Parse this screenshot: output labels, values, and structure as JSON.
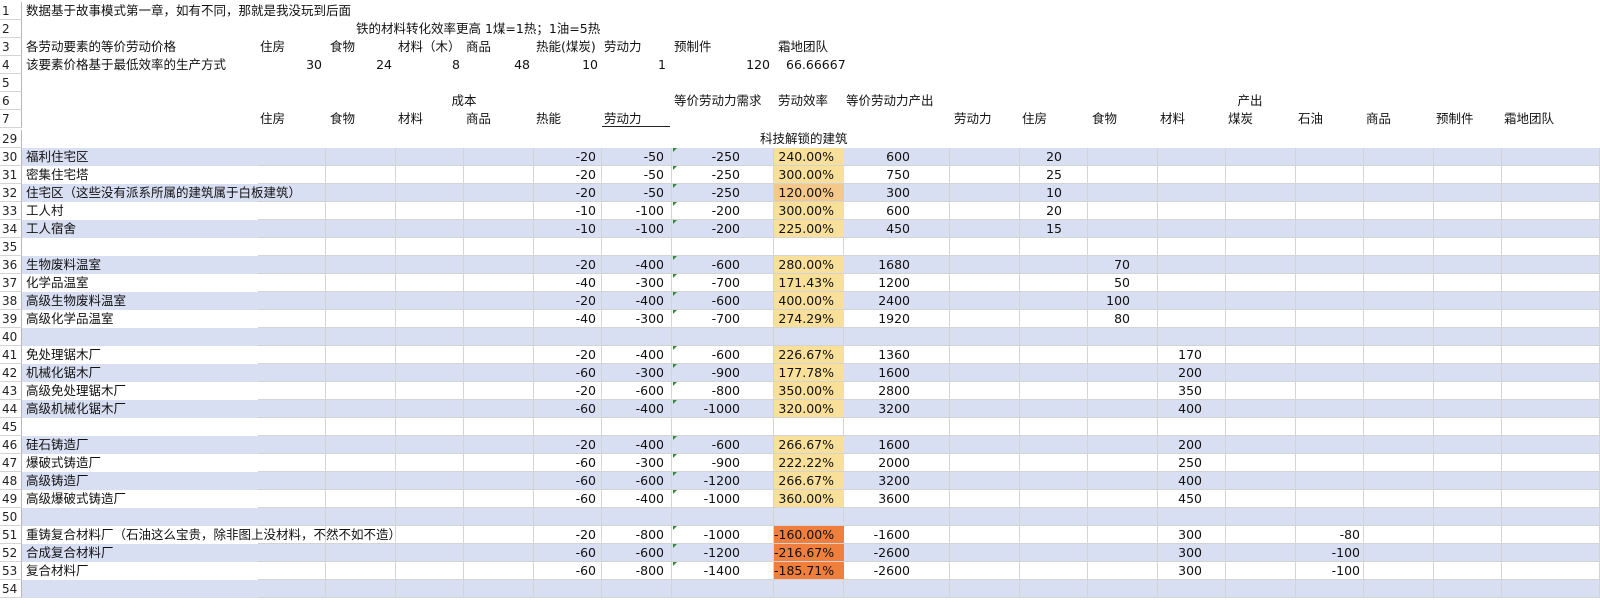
{
  "sheet": {
    "r1": {
      "num": "1",
      "a": "数据基于故事模式第一章，如有不同，那就是我没玩到后面"
    },
    "r2": {
      "num": "2",
      "note": "铁的材料转化效率更高  1煤=1热；1油=5热"
    },
    "r3": {
      "num": "3",
      "a": "各劳动要素的等价劳动价格",
      "b": "住房",
      "c": "食物",
      "d": "材料（木）",
      "e": "商品",
      "f": "热能(煤炭)",
      "g": "劳动力",
      "h": "预制件",
      "i": "霜地团队"
    },
    "r4": {
      "num": "4",
      "a": "该要素价格基于最低效率的生产方式",
      "b": "30",
      "c": "24",
      "d": "8",
      "e": "48",
      "f": "10",
      "g": "1",
      "h": "120",
      "i": "66.66667"
    },
    "r5": {
      "num": "5"
    },
    "r6": {
      "num": "6",
      "cost": "成本",
      "demand": "等价劳动力需求",
      "eff": "劳动效率",
      "output_eq": "等价劳动力产出",
      "output": "产出"
    },
    "r7": {
      "num": "7",
      "b": "住房",
      "c": "食物",
      "d": "材料",
      "e": "商品",
      "f": "热能",
      "g": "劳动力",
      "k": "劳动力",
      "l": "住房",
      "m": "食物",
      "n": "材料",
      "o": "煤炭",
      "p": "石油",
      "q": "商品",
      "r": "预制件",
      "s": "霜地团队"
    },
    "r29": {
      "num": "29",
      "title": "科技解锁的建筑"
    },
    "rows": [
      {
        "num": "30",
        "name": "福利住宅区",
        "heat": "-20",
        "labor": "-50",
        "demand": "-250",
        "eff": "240.00%",
        "out": "600",
        "housing": "20",
        "food": "",
        "mat": "",
        "oil": "",
        "band": true,
        "effc": "hi"
      },
      {
        "num": "31",
        "name": "密集住宅塔",
        "heat": "-20",
        "labor": "-50",
        "demand": "-250",
        "eff": "300.00%",
        "out": "750",
        "housing": "25",
        "food": "",
        "mat": "",
        "oil": "",
        "band": false,
        "effc": "hi"
      },
      {
        "num": "32",
        "name": "住宅区（这些没有派系所属的建筑属于白板建筑）",
        "heat": "-20",
        "labor": "-50",
        "demand": "-250",
        "eff": "120.00%",
        "out": "300",
        "housing": "10",
        "food": "",
        "mat": "",
        "oil": "",
        "band": true,
        "effc": "mid"
      },
      {
        "num": "33",
        "name": "工人村",
        "heat": "-10",
        "labor": "-100",
        "demand": "-200",
        "eff": "300.00%",
        "out": "600",
        "housing": "20",
        "food": "",
        "mat": "",
        "oil": "",
        "band": false,
        "effc": "hi"
      },
      {
        "num": "34",
        "name": "工人宿舍",
        "heat": "-10",
        "labor": "-100",
        "demand": "-200",
        "eff": "225.00%",
        "out": "450",
        "housing": "15",
        "food": "",
        "mat": "",
        "oil": "",
        "band": true,
        "effc": "hi"
      },
      {
        "num": "35",
        "name": "",
        "heat": "",
        "labor": "",
        "demand": "",
        "eff": "",
        "out": "",
        "housing": "",
        "food": "",
        "mat": "",
        "oil": "",
        "band": false,
        "effc": ""
      },
      {
        "num": "36",
        "name": "生物废料温室",
        "heat": "-20",
        "labor": "-400",
        "demand": "-600",
        "eff": "280.00%",
        "out": "1680",
        "housing": "",
        "food": "70",
        "mat": "",
        "oil": "",
        "band": true,
        "effc": "hi"
      },
      {
        "num": "37",
        "name": "化学品温室",
        "heat": "-40",
        "labor": "-300",
        "demand": "-700",
        "eff": "171.43%",
        "out": "1200",
        "housing": "",
        "food": "50",
        "mat": "",
        "oil": "",
        "band": false,
        "effc": "hi"
      },
      {
        "num": "38",
        "name": "高级生物废料温室",
        "heat": "-20",
        "labor": "-400",
        "demand": "-600",
        "eff": "400.00%",
        "out": "2400",
        "housing": "",
        "food": "100",
        "mat": "",
        "oil": "",
        "band": true,
        "effc": "hi"
      },
      {
        "num": "39",
        "name": "高级化学品温室",
        "heat": "-40",
        "labor": "-300",
        "demand": "-700",
        "eff": "274.29%",
        "out": "1920",
        "housing": "",
        "food": "80",
        "mat": "",
        "oil": "",
        "band": false,
        "effc": "hi"
      },
      {
        "num": "40",
        "name": "",
        "heat": "",
        "labor": "",
        "demand": "",
        "eff": "",
        "out": "",
        "housing": "",
        "food": "",
        "mat": "",
        "oil": "",
        "band": true,
        "effc": ""
      },
      {
        "num": "41",
        "name": "免处理锯木厂",
        "heat": "-20",
        "labor": "-400",
        "demand": "-600",
        "eff": "226.67%",
        "out": "1360",
        "housing": "",
        "food": "",
        "mat": "170",
        "oil": "",
        "band": false,
        "effc": "hi"
      },
      {
        "num": "42",
        "name": "机械化锯木厂",
        "heat": "-60",
        "labor": "-300",
        "demand": "-900",
        "eff": "177.78%",
        "out": "1600",
        "housing": "",
        "food": "",
        "mat": "200",
        "oil": "",
        "band": true,
        "effc": "hi"
      },
      {
        "num": "43",
        "name": "高级免处理锯木厂",
        "heat": "-20",
        "labor": "-600",
        "demand": "-800",
        "eff": "350.00%",
        "out": "2800",
        "housing": "",
        "food": "",
        "mat": "350",
        "oil": "",
        "band": false,
        "effc": "hi"
      },
      {
        "num": "44",
        "name": "高级机械化锯木厂",
        "heat": "-60",
        "labor": "-400",
        "demand": "-1000",
        "eff": "320.00%",
        "out": "3200",
        "housing": "",
        "food": "",
        "mat": "400",
        "oil": "",
        "band": true,
        "effc": "hi"
      },
      {
        "num": "45",
        "name": "",
        "heat": "",
        "labor": "",
        "demand": "",
        "eff": "",
        "out": "",
        "housing": "",
        "food": "",
        "mat": "",
        "oil": "",
        "band": false,
        "effc": ""
      },
      {
        "num": "46",
        "name": "硅石铸造厂",
        "heat": "-20",
        "labor": "-400",
        "demand": "-600",
        "eff": "266.67%",
        "out": "1600",
        "housing": "",
        "food": "",
        "mat": "200",
        "oil": "",
        "band": true,
        "effc": "hi"
      },
      {
        "num": "47",
        "name": "爆破式铸造厂",
        "heat": "-60",
        "labor": "-300",
        "demand": "-900",
        "eff": "222.22%",
        "out": "2000",
        "housing": "",
        "food": "",
        "mat": "250",
        "oil": "",
        "band": false,
        "effc": "hi"
      },
      {
        "num": "48",
        "name": "高级铸造厂",
        "heat": "-60",
        "labor": "-600",
        "demand": "-1200",
        "eff": "266.67%",
        "out": "3200",
        "housing": "",
        "food": "",
        "mat": "400",
        "oil": "",
        "band": true,
        "effc": "hi"
      },
      {
        "num": "49",
        "name": "高级爆破式铸造厂",
        "heat": "-60",
        "labor": "-400",
        "demand": "-1000",
        "eff": "360.00%",
        "out": "3600",
        "housing": "",
        "food": "",
        "mat": "450",
        "oil": "",
        "band": false,
        "effc": "hi"
      },
      {
        "num": "50",
        "name": "",
        "heat": "",
        "labor": "",
        "demand": "",
        "eff": "",
        "out": "",
        "housing": "",
        "food": "",
        "mat": "",
        "oil": "",
        "band": true,
        "effc": ""
      },
      {
        "num": "51",
        "name": "重铸复合材料厂（石油这么宝贵，除非图上没材料，不然不如不造）",
        "heat": "-20",
        "labor": "-800",
        "demand": "-1000",
        "eff": "-160.00%",
        "out": "-1600",
        "housing": "",
        "food": "",
        "mat": "300",
        "oil": "-80",
        "band": false,
        "effc": "neg"
      },
      {
        "num": "52",
        "name": "合成复合材料厂",
        "heat": "-60",
        "labor": "-600",
        "demand": "-1200",
        "eff": "-216.67%",
        "out": "-2600",
        "housing": "",
        "food": "",
        "mat": "300",
        "oil": "-100",
        "band": true,
        "effc": "neg"
      },
      {
        "num": "53",
        "name": "复合材料厂",
        "heat": "-60",
        "labor": "-800",
        "demand": "-1400",
        "eff": "-185.71%",
        "out": "-2600",
        "housing": "",
        "food": "",
        "mat": "300",
        "oil": "-100",
        "band": false,
        "effc": "neg"
      },
      {
        "num": "54",
        "name": "",
        "heat": "",
        "labor": "",
        "demand": "",
        "eff": "",
        "out": "",
        "housing": "",
        "food": "",
        "mat": "",
        "oil": "",
        "band": true,
        "effc": ""
      }
    ]
  }
}
